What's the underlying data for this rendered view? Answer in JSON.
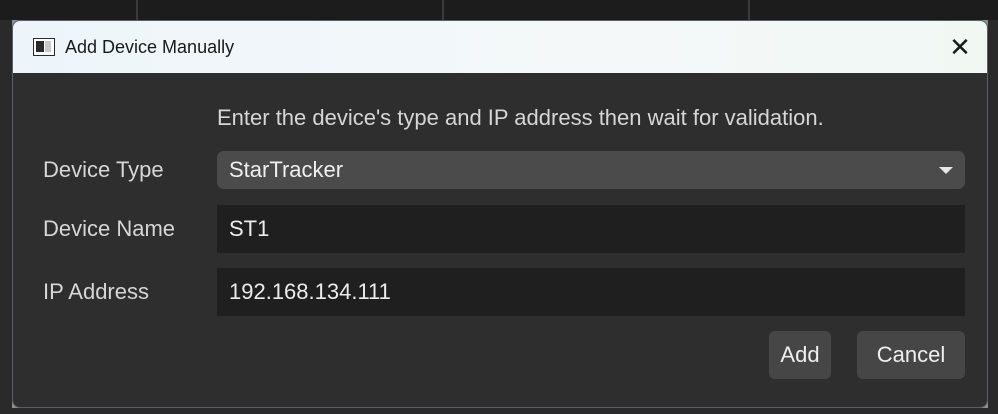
{
  "dialog": {
    "title": "Add Device Manually",
    "close_glyph": "✕"
  },
  "form": {
    "instruction": "Enter the device's type and IP address then wait for validation.",
    "device_type": {
      "label": "Device Type",
      "value": "StarTracker"
    },
    "device_name": {
      "label": "Device Name",
      "value": "ST1"
    },
    "ip_address": {
      "label": "IP Address",
      "value": "192.168.134.111"
    }
  },
  "buttons": {
    "add": "Add",
    "cancel": "Cancel"
  },
  "icons": {
    "app": "window-app-icon",
    "close": "close-icon",
    "dropdown": "chevron-down-icon"
  }
}
